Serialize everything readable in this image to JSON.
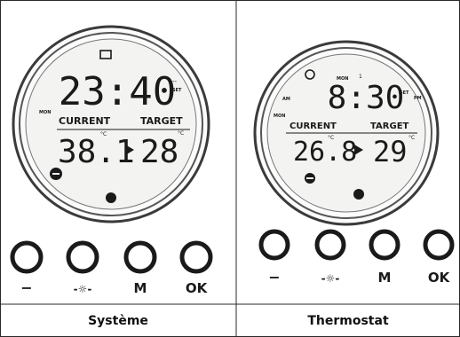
{
  "panels": [
    {
      "caption": "Système",
      "time": "23:40",
      "current_label": "CURRENT",
      "target_label": "TARGET",
      "current_temp": "38.1",
      "target_temp": "28",
      "buttons": [
        "−",
        "-☼-",
        "M",
        "OK"
      ]
    },
    {
      "caption": "Thermostat",
      "time": "8:30",
      "current_label": "CURRENT",
      "target_label": "TARGET",
      "current_temp": "26.8",
      "target_temp": "29",
      "buttons": [
        "−",
        "-☼-",
        "M",
        "OK"
      ]
    }
  ],
  "colors": {
    "line": "#2a2a2a",
    "lcd_text": "#1a1a1a",
    "ring": "#3a3a3a",
    "background": "#ffffff"
  }
}
